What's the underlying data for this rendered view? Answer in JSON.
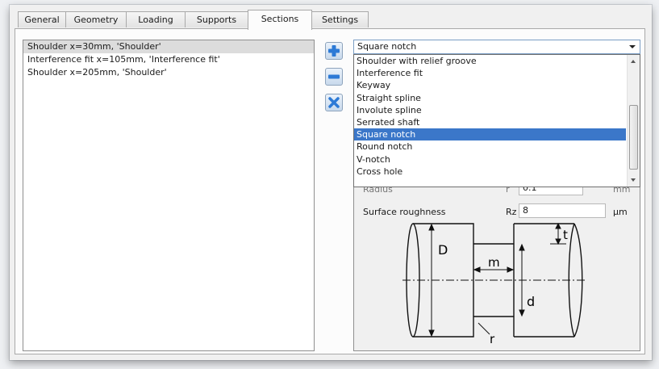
{
  "tabs": [
    {
      "label": "General"
    },
    {
      "label": "Geometry"
    },
    {
      "label": "Loading"
    },
    {
      "label": "Supports"
    },
    {
      "label": "Sections"
    },
    {
      "label": "Settings"
    }
  ],
  "active_tab": "Sections",
  "sections_list": [
    {
      "label": "Shoulder x=30mm, 'Shoulder'"
    },
    {
      "label": "Interference fit x=105mm, 'Interference fit'"
    },
    {
      "label": "Shoulder x=205mm, 'Shoulder'"
    }
  ],
  "side_buttons": {
    "add": "add-icon",
    "remove": "remove-icon",
    "delete": "delete-icon"
  },
  "notch_type": {
    "selected": "Square notch",
    "options": [
      {
        "label": "Shoulder with relief groove"
      },
      {
        "label": "Interference fit"
      },
      {
        "label": "Keyway"
      },
      {
        "label": "Straight spline"
      },
      {
        "label": "Involute spline"
      },
      {
        "label": "Serrated shaft"
      },
      {
        "label": "Square notch"
      },
      {
        "label": "Round notch"
      },
      {
        "label": "V-notch"
      },
      {
        "label": "Cross hole"
      }
    ]
  },
  "fields": {
    "radius": {
      "label": "Radius",
      "symbol": "r",
      "value": "0.1",
      "unit": "mm"
    },
    "surface_roughness": {
      "label": "Surface roughness",
      "symbol": "Rz",
      "value": "8",
      "unit": "µm"
    }
  },
  "diagram_labels": {
    "D": "D",
    "d": "d",
    "m": "m",
    "t": "t",
    "r": "r"
  },
  "colors": {
    "selection": "#3b77c9",
    "button_blue": "#2d7ad6"
  }
}
